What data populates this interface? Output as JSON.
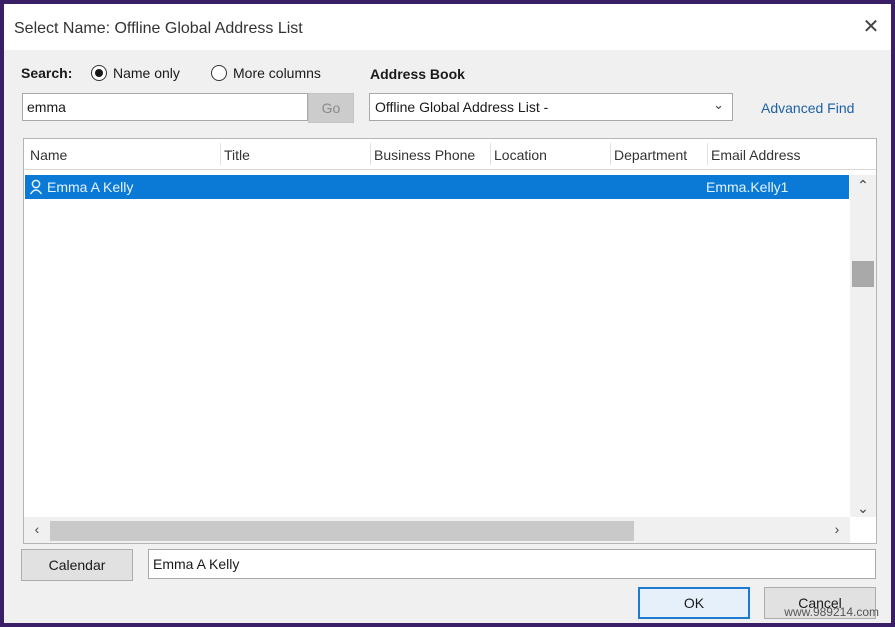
{
  "window": {
    "title": "Select Name: Offline Global Address List",
    "close_label": "✕"
  },
  "search": {
    "label": "Search:",
    "radio_name_only": "Name only",
    "radio_more_columns": "More columns",
    "selected_option": "Name only",
    "query": "emma",
    "go_label": "Go"
  },
  "address_book": {
    "label": "Address Book",
    "selected": "Offline Global Address List -",
    "advanced_find": "Advanced Find"
  },
  "table": {
    "columns": [
      "Name",
      "Title",
      "Business Phone",
      "Location",
      "Department",
      "Email Address"
    ],
    "rows": [
      {
        "name": "Emma A Kelly",
        "title": "",
        "business_phone": "",
        "location": "",
        "department": "",
        "email": "Emma.Kelly1"
      }
    ]
  },
  "footer": {
    "calendar_label": "Calendar",
    "selected_name": "Emma A Kelly",
    "ok_label": "OK",
    "cancel_label": "Cancel"
  },
  "watermark": "www.989214.com",
  "colors": {
    "selection": "#0a7ad6",
    "link": "#1d5fa8",
    "frame_border": "#3a1f66"
  }
}
